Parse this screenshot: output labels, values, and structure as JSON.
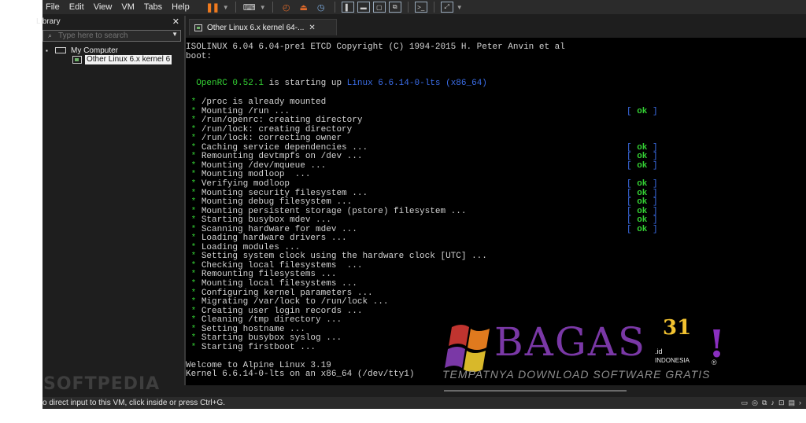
{
  "menu": [
    "File",
    "Edit",
    "View",
    "VM",
    "Tabs",
    "Help"
  ],
  "toolbar": {
    "icons": [
      "pause-icon",
      "send-keys-icon",
      "snapshot-icon",
      "revert-icon",
      "snapshot-manager-icon",
      "normal-view-icon",
      "fullscreen-icon",
      "unity-icon",
      "console-icon",
      "stretch-icon"
    ]
  },
  "library": {
    "title": "Library",
    "search_placeholder": "Type here to search",
    "root": "My Computer",
    "vm": "Other Linux 6.x kernel 6"
  },
  "tab": {
    "label": "Other Linux 6.x kernel 64-..."
  },
  "console": {
    "lines": [
      "ISOLINUX 6.04 6.04-pre1 ETCD Copyright (C) 1994-2015 H. Peter Anvin et al",
      "boot:"
    ],
    "openrc_prefix": "OpenRC",
    "openrc_version": "0.52.1",
    "openrc_mid": "is starting up",
    "openrc_os": "Linux 6.6.14-0-lts (x86_64)",
    "boot_lines": [
      {
        "t": "/proc is already mounted",
        "ok": false
      },
      {
        "t": "Mounting /run ...",
        "ok": true
      },
      {
        "t": "/run/openrc: creating directory",
        "ok": false
      },
      {
        "t": "/run/lock: creating directory",
        "ok": false
      },
      {
        "t": "/run/lock: correcting owner",
        "ok": false
      },
      {
        "t": "Caching service dependencies ...",
        "ok": true
      },
      {
        "t": "Remounting devtmpfs on /dev ...",
        "ok": true
      },
      {
        "t": "Mounting /dev/mqueue ...",
        "ok": true
      },
      {
        "t": "Mounting modloop  ...",
        "ok": false
      },
      {
        "t": "Verifying modloop",
        "ok": true
      },
      {
        "t": "Mounting security filesystem ...",
        "ok": true
      },
      {
        "t": "Mounting debug filesystem ...",
        "ok": true
      },
      {
        "t": "Mounting persistent storage (pstore) filesystem ...",
        "ok": true
      },
      {
        "t": "Starting busybox mdev ...",
        "ok": true
      },
      {
        "t": "Scanning hardware for mdev ...",
        "ok": true
      },
      {
        "t": "Loading hardware drivers ...",
        "ok": false
      },
      {
        "t": "Loading modules ...",
        "ok": false
      },
      {
        "t": "Setting system clock using the hardware clock [UTC] ...",
        "ok": false
      },
      {
        "t": "Checking local filesystems  ...",
        "ok": false
      },
      {
        "t": "Remounting filesystems ...",
        "ok": false
      },
      {
        "t": "Mounting local filesystems ...",
        "ok": false
      },
      {
        "t": "Configuring kernel parameters ...",
        "ok": false
      },
      {
        "t": "Migrating /var/lock to /run/lock ...",
        "ok": false
      },
      {
        "t": "Creating user login records ...",
        "ok": false
      },
      {
        "t": "Cleaning /tmp directory ...",
        "ok": false
      },
      {
        "t": "Setting hostname ...",
        "ok": false
      },
      {
        "t": "Starting busybox syslog ...",
        "ok": false
      },
      {
        "t": "Starting firstboot ...",
        "ok": false
      }
    ],
    "ok_label": "[ ok ]",
    "welcome": "Welcome to Alpine Linux 3.19",
    "kernel": "Kernel 6.6.14-0-lts on an x86_64 (/dev/tty1)"
  },
  "watermarks": {
    "softpedia": "SOFTPEDIA",
    "bagas_title": "BAGAS",
    "bagas_num": "31",
    "bagas_excl": "!",
    "bagas_id": ".id",
    "bagas_country": "INDONESIA",
    "bagas_tagline": "TEMPATNYA DOWNLOAD SOFTWARE GRATIS",
    "bagas_reg": "®"
  },
  "status": {
    "message": "o direct input to this VM, click inside or press Ctrl+G."
  },
  "colors": {
    "green": "#34d134",
    "blue": "#3b6de8",
    "accent_orange": "#f07a1e"
  }
}
